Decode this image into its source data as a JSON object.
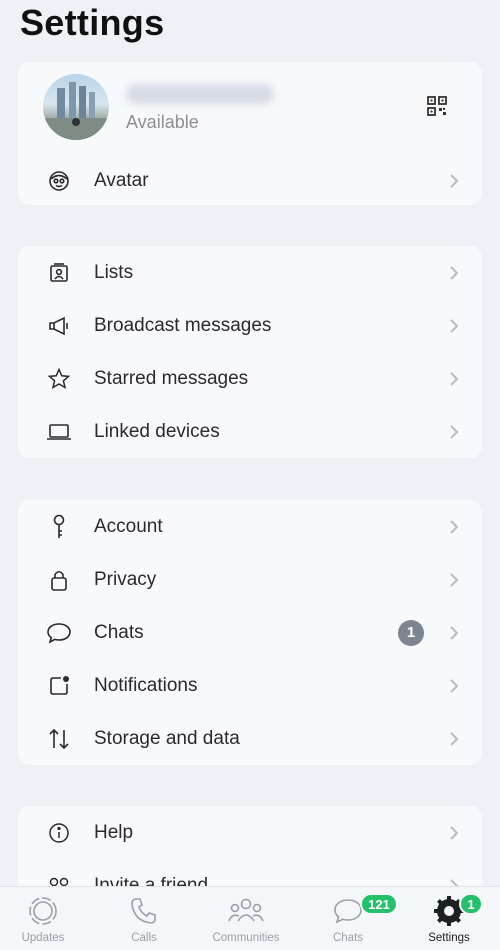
{
  "header": {
    "title": "Settings"
  },
  "profile": {
    "status": "Available"
  },
  "section1": [
    {
      "label": "Avatar",
      "icon": "avatar-face-icon"
    }
  ],
  "section2": [
    {
      "label": "Lists",
      "icon": "lists-icon"
    },
    {
      "label": "Broadcast messages",
      "icon": "megaphone-icon"
    },
    {
      "label": "Starred messages",
      "icon": "star-icon"
    },
    {
      "label": "Linked devices",
      "icon": "laptop-icon"
    }
  ],
  "section3": [
    {
      "label": "Account",
      "icon": "key-icon"
    },
    {
      "label": "Privacy",
      "icon": "lock-icon"
    },
    {
      "label": "Chats",
      "icon": "chat-bubble-icon",
      "badge": "1"
    },
    {
      "label": "Notifications",
      "icon": "notification-icon"
    },
    {
      "label": "Storage and data",
      "icon": "arrows-up-down-icon"
    }
  ],
  "section4": [
    {
      "label": "Help",
      "icon": "info-icon"
    },
    {
      "label": "Invite a friend",
      "icon": "people-icon"
    }
  ],
  "tabbar": {
    "tabs": [
      {
        "label": "Updates",
        "icon": "updates-icon"
      },
      {
        "label": "Calls",
        "icon": "phone-icon"
      },
      {
        "label": "Communities",
        "icon": "communities-icon"
      },
      {
        "label": "Chats",
        "icon": "chats-icon",
        "badge": "121"
      },
      {
        "label": "Settings",
        "icon": "settings-gear-icon",
        "badge": "1",
        "active": true
      }
    ]
  },
  "colors": {
    "badge_green": "#25c06a",
    "badge_gray": "#7d8590",
    "background": "#eef1f6"
  }
}
